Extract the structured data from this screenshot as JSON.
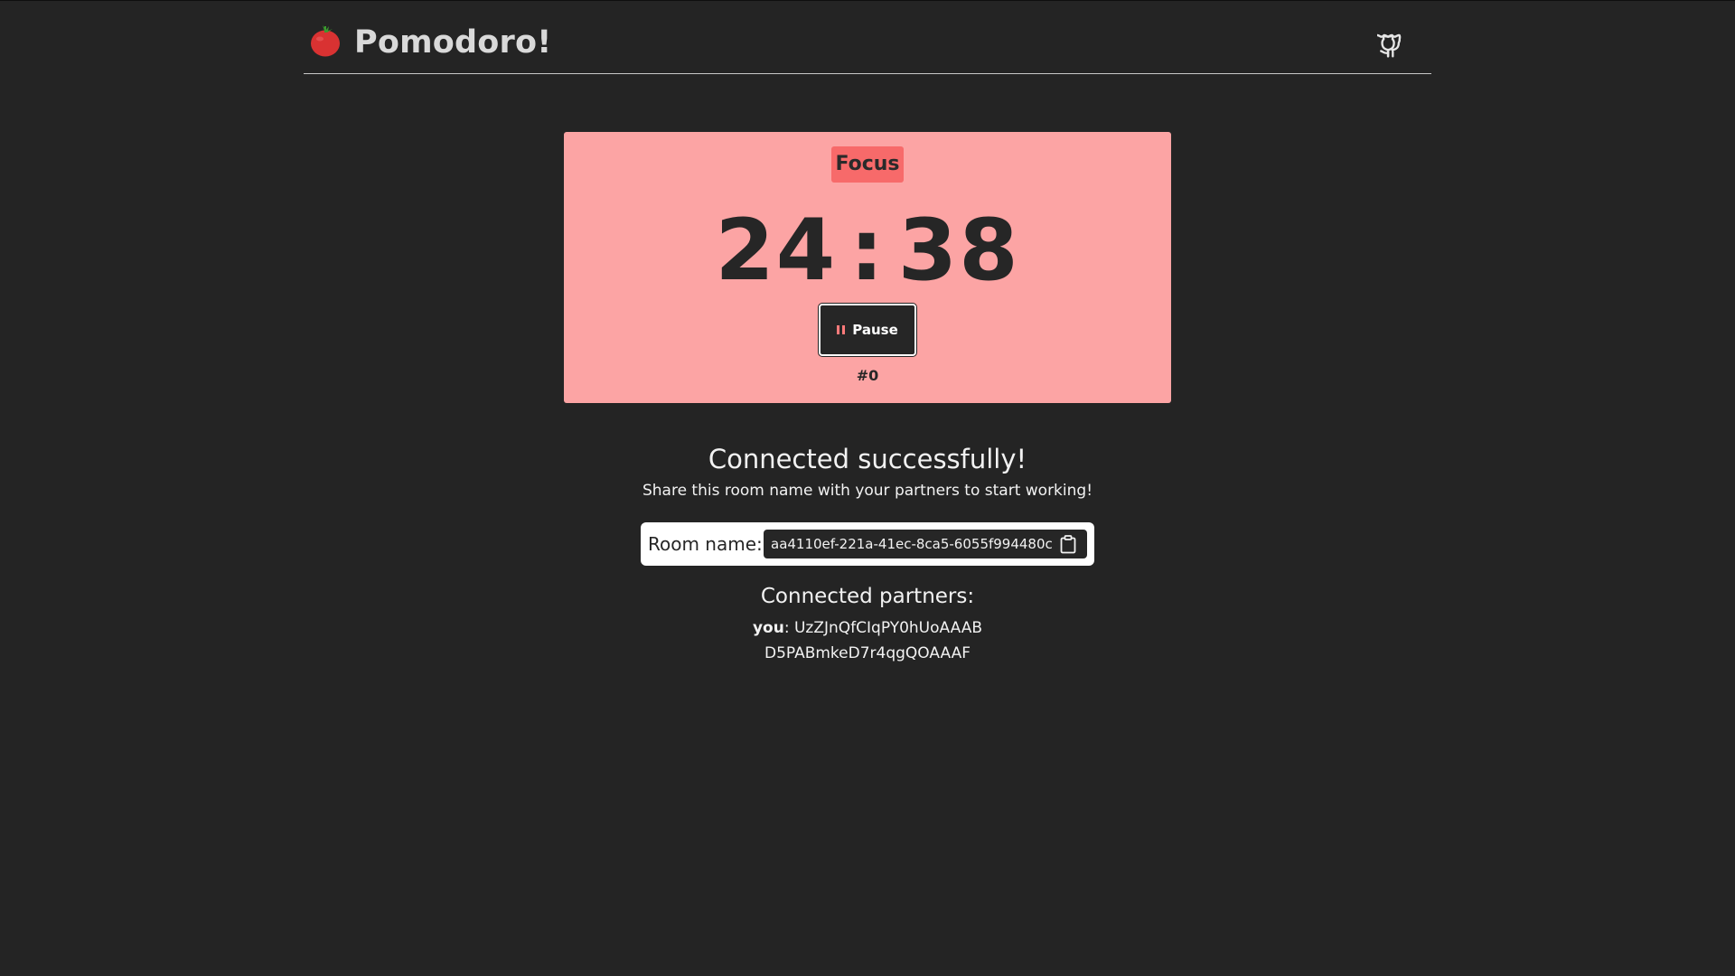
{
  "header": {
    "title": "Pomodoro!",
    "logo_icon": "tomato-icon",
    "github_icon": "github-icon"
  },
  "timer": {
    "mode": "Focus",
    "minutes": "24",
    "separator": ":",
    "seconds": "38",
    "pause_label": "Pause",
    "session_count": "#0",
    "card_color": "#fca4a4",
    "badge_color": "#f76a6a"
  },
  "connection": {
    "status_title": "Connected successfully!",
    "status_subtitle": "Share this room name with your partners to start working!",
    "room_label": "Room name:",
    "room_name": "aa4110ef-221a-41ec-8ca5-6055f994480c",
    "copy_icon": "clipboard-icon"
  },
  "partners": {
    "title": "Connected partners:",
    "self_prefix": "you",
    "self_suffix": ":",
    "items": [
      "UzZJnQfCIqPY0hUoAAAB",
      "D5PABmkeD7r4qgQOAAAF"
    ]
  }
}
